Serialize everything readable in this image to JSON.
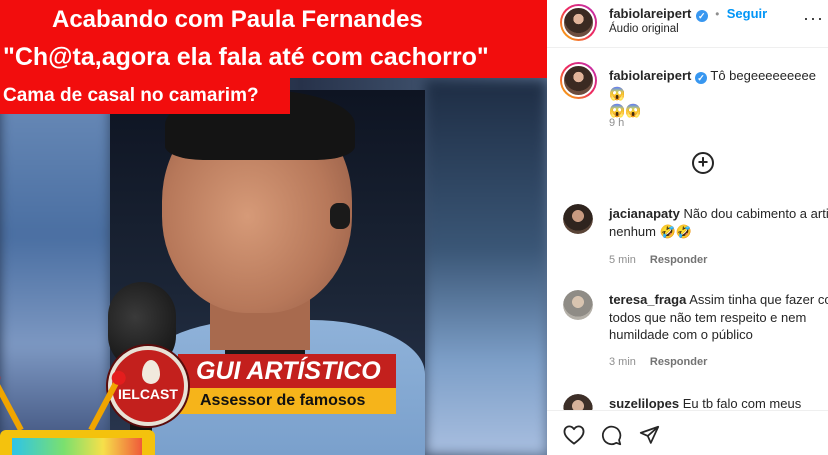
{
  "video": {
    "headline_1": "Acabando com Paula Fernandes",
    "headline_2": "\"Ch@ta,agora ela fala até com cachorro\"",
    "headline_3": "Cama de casal no camarim?",
    "badge_text": "IELCAST",
    "guest_name": "GUI ARTÍSTICO",
    "guest_role": "Assessor de famosos"
  },
  "post_header": {
    "username": "fabiolareipert",
    "follow_label": "Seguir",
    "separator": "•",
    "audio_label": "Áudio original"
  },
  "caption": {
    "username": "fabiolareipert",
    "text": "Tô begeeeeeeeee 😱",
    "text_line2": "😱😱",
    "time": "9 h"
  },
  "comments": [
    {
      "username": "jacianapaty",
      "line1": "Não dou cabimento a artis",
      "line2": "nenhum 🤣🤣",
      "time": "5 min",
      "reply": "Responder"
    },
    {
      "username": "teresa_fraga",
      "line1": "Assim tinha que fazer com",
      "line2": "todos que não tem respeito e nem",
      "line3": "humildade com o público",
      "time": "3 min",
      "reply": "Responder"
    },
    {
      "username": "suzelilopes",
      "line1": "Eu tb falo com meus"
    }
  ],
  "icons": {
    "verified": "verified-badge-icon",
    "more": "more-options-icon",
    "load_more": "plus-circle-icon",
    "like": "heart-icon",
    "comment": "comment-icon",
    "share": "send-icon"
  },
  "colors": {
    "accent": "#0095f6",
    "headline_bg": "#f20d0d",
    "name_bar": "#c3201d",
    "role_bar": "#f6b41a"
  }
}
